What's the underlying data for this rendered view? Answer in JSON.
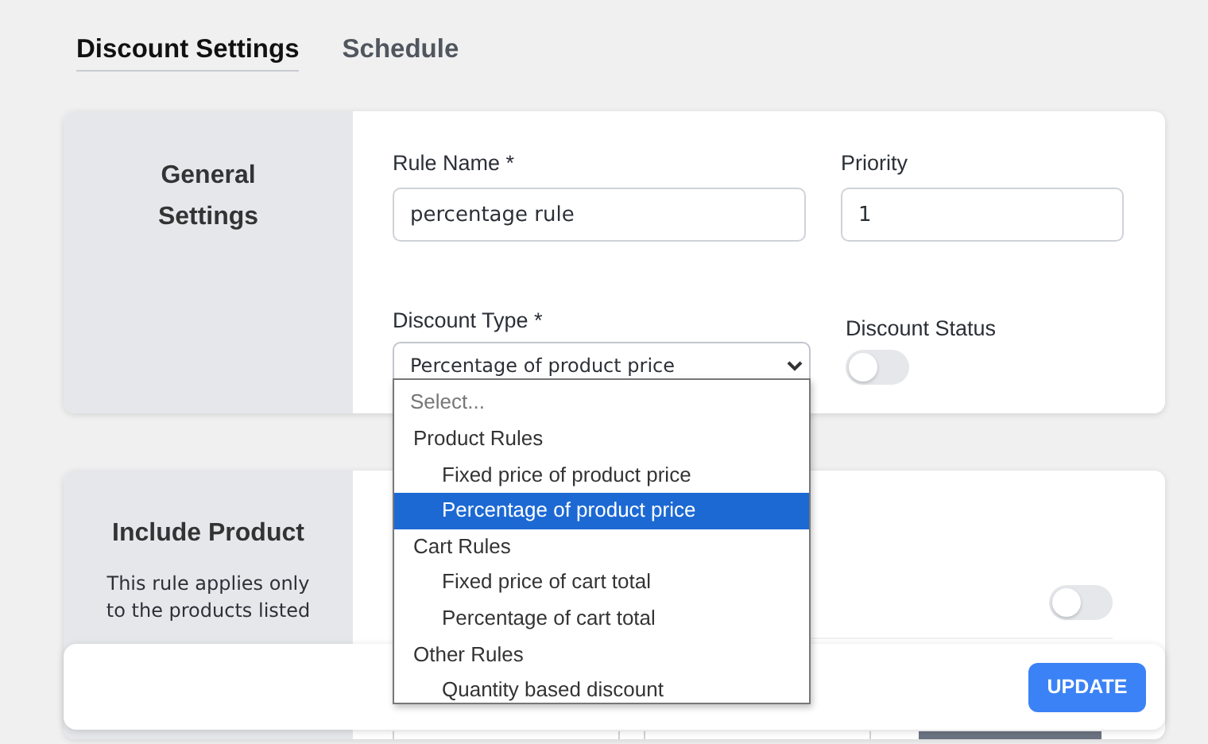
{
  "tabs": [
    {
      "label": "Discount Settings",
      "selected": true
    },
    {
      "label": "Schedule",
      "selected": false
    }
  ],
  "general_settings": {
    "title": "General Settings",
    "rule_name": {
      "label": "Rule Name *",
      "value": "percentage rule"
    },
    "priority": {
      "label": "Priority",
      "value": "1"
    },
    "discount_type": {
      "label": "Discount Type *",
      "value": "Percentage of product price",
      "expanded": true
    },
    "discount_status": {
      "label": "Discount Status",
      "on": false
    }
  },
  "discount_type_menu": {
    "placeholder": "Select...",
    "groups": [
      {
        "label": "Product Rules",
        "options": [
          {
            "label": "Fixed price of product price",
            "selected": false
          },
          {
            "label": "Percentage of product price",
            "selected": true
          }
        ]
      },
      {
        "label": "Cart Rules",
        "options": [
          {
            "label": "Fixed price of cart total",
            "selected": false
          },
          {
            "label": "Percentage of cart total",
            "selected": false
          }
        ]
      },
      {
        "label": "Other Rules",
        "options": [
          {
            "label": "Quantity based discount",
            "selected": false
          }
        ]
      }
    ]
  },
  "include_product": {
    "title": "Include Product",
    "description": "This rule applies only to the products listed",
    "on": false
  },
  "save_bar": {
    "button": "UPDATE"
  }
}
